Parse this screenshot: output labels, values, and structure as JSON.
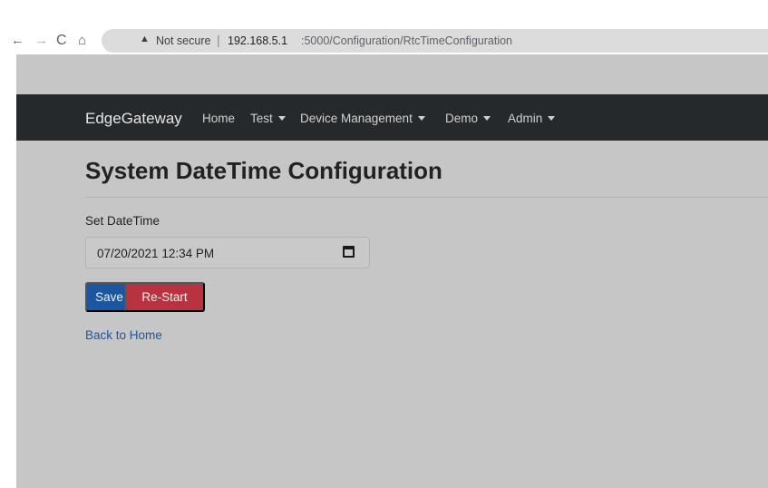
{
  "browser": {
    "back": "←",
    "forward": "→",
    "reload": "C",
    "home": "⌂",
    "warning": "▲",
    "security_label": "Not secure",
    "separator": "|",
    "url_host": "192.168.5.1",
    "url_rest": ":5000/Configuration/RtcTimeConfiguration"
  },
  "navbar": {
    "brand": "EdgeGateway",
    "items": [
      {
        "label": "Home",
        "dropdown": false
      },
      {
        "label": "Test",
        "dropdown": true
      },
      {
        "label": "Device Management",
        "dropdown": true
      },
      {
        "label": "Demo",
        "dropdown": true
      },
      {
        "label": "Admin",
        "dropdown": true
      }
    ]
  },
  "page": {
    "title": "System DateTime Configuration",
    "field_label": "Set DateTime",
    "datetime_value": "07/20/2021 12:34 PM",
    "save_label": "Save",
    "restart_label": "Re-Start",
    "back_link": "Back to Home"
  },
  "colors": {
    "navbar_bg": "#25292c",
    "primary": "#1b56a0",
    "danger": "#b8323f",
    "page_bg": "#c6c6c6"
  }
}
